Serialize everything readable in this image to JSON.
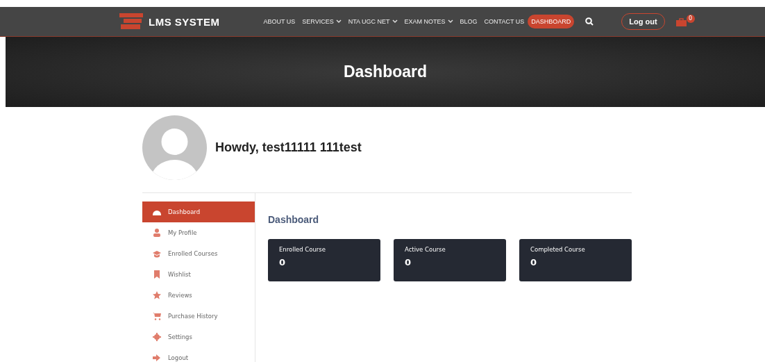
{
  "header": {
    "logo": "LMS SYSTEM",
    "nav": [
      {
        "label": "ABOUT US",
        "dropdown": false,
        "selected": false
      },
      {
        "label": "SERVICES",
        "dropdown": true,
        "selected": false
      },
      {
        "label": "NTA UGC NET",
        "dropdown": true,
        "selected": false
      },
      {
        "label": "EXAM NOTES",
        "dropdown": true,
        "selected": false
      },
      {
        "label": "BLOG",
        "dropdown": false,
        "selected": false
      },
      {
        "label": "CONTACT US",
        "dropdown": false,
        "selected": false
      },
      {
        "label": "DASHBOARD",
        "dropdown": false,
        "selected": true
      }
    ],
    "logout": "Log out",
    "cart_count": "0"
  },
  "banner": {
    "title": "Dashboard"
  },
  "greeting": "Howdy, test11111 111test",
  "sidebar": {
    "items": [
      {
        "label": "Dashboard",
        "selected": true
      },
      {
        "label": "My Profile",
        "selected": false
      },
      {
        "label": "Enrolled Courses",
        "selected": false
      },
      {
        "label": "Wishlist",
        "selected": false
      },
      {
        "label": "Reviews",
        "selected": false
      },
      {
        "label": "Purchase History",
        "selected": false
      },
      {
        "label": "Settings",
        "selected": false
      },
      {
        "label": "Logout",
        "selected": false
      }
    ]
  },
  "main": {
    "title": "Dashboard",
    "stats": [
      {
        "label": "Enrolled Course",
        "value": "0"
      },
      {
        "label": "Active Course",
        "value": "0"
      },
      {
        "label": "Completed Course",
        "value": "0"
      }
    ]
  }
}
